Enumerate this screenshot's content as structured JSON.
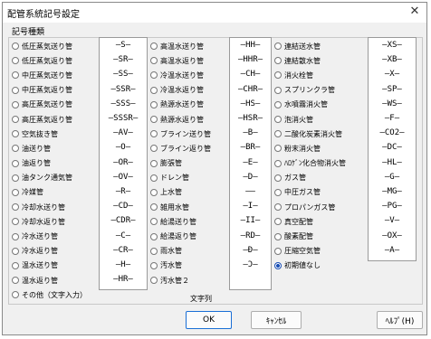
{
  "window": {
    "title": "配管系統記号設定",
    "close_glyph": "✕"
  },
  "group": {
    "label": "記号種類"
  },
  "column1": [
    "低圧蒸気送り管",
    "低圧蒸気返り管",
    "中圧蒸気送り管",
    "中圧蒸気返り管",
    "高圧蒸気送り管",
    "高圧蒸気返り管",
    "空気抜き管",
    "油送り管",
    "油返り管",
    "油タンク通気管",
    "冷媒管",
    "冷却水送り管",
    "冷却水返り管",
    "冷水送り管",
    "冷水返り管",
    "温水送り管",
    "温水返り管",
    "その他（文字入力）"
  ],
  "symbols1": [
    "—S—",
    "—SR—",
    "—SS—",
    "—SSR—",
    "—SSS—",
    "—SSSR—",
    "—AV—",
    "—O—",
    "—OR—",
    "—OV—",
    "—R—",
    "—CD—",
    "—CDR—",
    "—C—",
    "—CR—",
    "—H—",
    "—HR—"
  ],
  "column2": [
    "高温水送り管",
    "高温水返り管",
    "冷温水送り管",
    "冷温水返り管",
    "熱源水送り管",
    "熱源水返り管",
    "ブライン送り管",
    "ブライン返り管",
    "膨張管",
    "ドレン管",
    "上水管",
    "雑用水管",
    "給湯送り管",
    "給湯返り管",
    "雨水管",
    "汚水管",
    "汚水管２"
  ],
  "symbols2": [
    "—HH—",
    "—HHR—",
    "—CH—",
    "—CHR—",
    "—HS—",
    "—HSR—",
    "—B—",
    "—BR—",
    "—E—",
    "—D—",
    "——",
    "—I—",
    "—II—",
    "—RD—",
    "—Ð—",
    "—Ɔ—"
  ],
  "column3": [
    "連結送水管",
    "連結散水管",
    "消火栓管",
    "スプリンクラ管",
    "水噴霧消火管",
    "泡消火管",
    "二酸化炭素消火管",
    "粉末消火管",
    "ﾊﾛｹﾞﾝ化合物消火管",
    "ガス管",
    "中圧ガス管",
    "プロパンガス管",
    "真空配管",
    "酸素配管",
    "圧縮空気管",
    "初期値なし"
  ],
  "selected_radio": "初期値なし",
  "symbols3": [
    "—XS—",
    "—XB—",
    "—X—",
    "—SP—",
    "—WS—",
    "—F—",
    "—CO2—",
    "—DC—",
    "—HL—",
    "—G—",
    "—MG—",
    "—PG—",
    "—V—",
    "—OX—",
    "—A—"
  ],
  "text_label": "文字列",
  "buttons": {
    "ok": "OK",
    "cancel": "ｷｬﾝｾﾙ",
    "help": "ﾍﾙﾌﾟ(H)"
  }
}
